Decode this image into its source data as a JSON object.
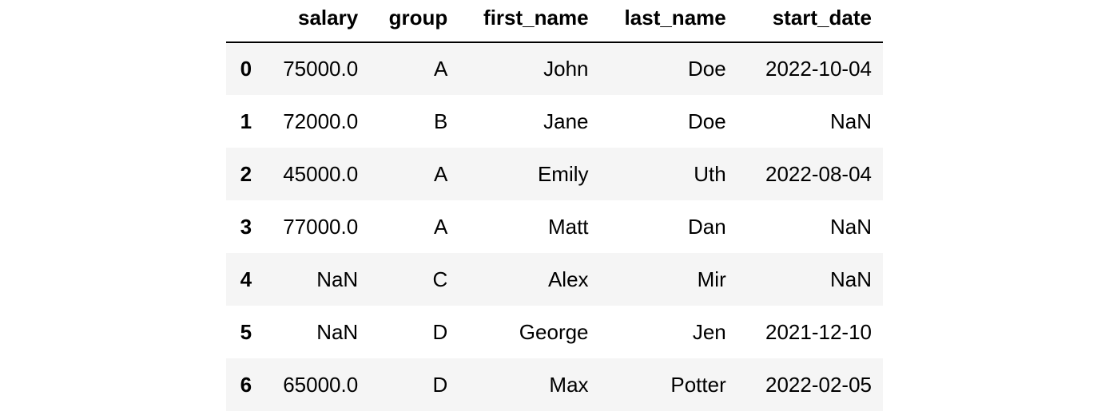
{
  "table": {
    "columns": [
      "",
      "salary",
      "group",
      "first_name",
      "last_name",
      "start_date"
    ],
    "rows": [
      [
        "0",
        "75000.0",
        "A",
        "John",
        "Doe",
        "2022-10-04"
      ],
      [
        "1",
        "72000.0",
        "B",
        "Jane",
        "Doe",
        "NaN"
      ],
      [
        "2",
        "45000.0",
        "A",
        "Emily",
        "Uth",
        "2022-08-04"
      ],
      [
        "3",
        "77000.0",
        "A",
        "Matt",
        "Dan",
        "NaN"
      ],
      [
        "4",
        "NaN",
        "C",
        "Alex",
        "Mir",
        "NaN"
      ],
      [
        "5",
        "NaN",
        "D",
        "George",
        "Jen",
        "2021-12-10"
      ],
      [
        "6",
        "65000.0",
        "D",
        "Max",
        "Potter",
        "2022-02-05"
      ]
    ],
    "stripe_color": "#f5f5f5"
  }
}
